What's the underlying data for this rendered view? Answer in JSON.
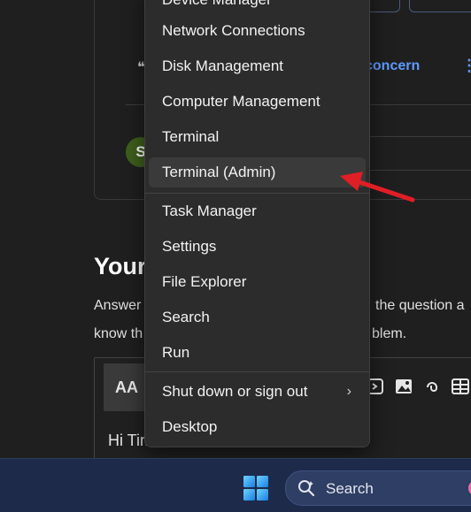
{
  "page": {
    "concern_link": "concern",
    "avatar_letter": "S",
    "answer_heading": "Your",
    "answer_line1": "Answer",
    "answer_line1_right": "the question a",
    "answer_line2": "know th",
    "answer_line2_right": "blem.",
    "editor_format_label": "AA",
    "editor_text": "Hi Tim"
  },
  "menu": {
    "items": [
      {
        "label": "Device Manager"
      },
      {
        "label": "Network Connections"
      },
      {
        "label": "Disk Management"
      },
      {
        "label": "Computer Management"
      },
      {
        "label": "Terminal"
      },
      {
        "label": "Terminal (Admin)"
      },
      {
        "label": "Task Manager"
      },
      {
        "label": "Settings"
      },
      {
        "label": "File Explorer"
      },
      {
        "label": "Search"
      },
      {
        "label": "Run"
      },
      {
        "label": "Shut down or sign out"
      },
      {
        "label": "Desktop"
      }
    ]
  },
  "taskbar": {
    "search_label": "Search"
  },
  "colors": {
    "accent": "#5d9bff",
    "annotation_arrow": "#e01e25",
    "taskbar": "#1d2a4a",
    "menu_bg": "#2c2c2c"
  }
}
